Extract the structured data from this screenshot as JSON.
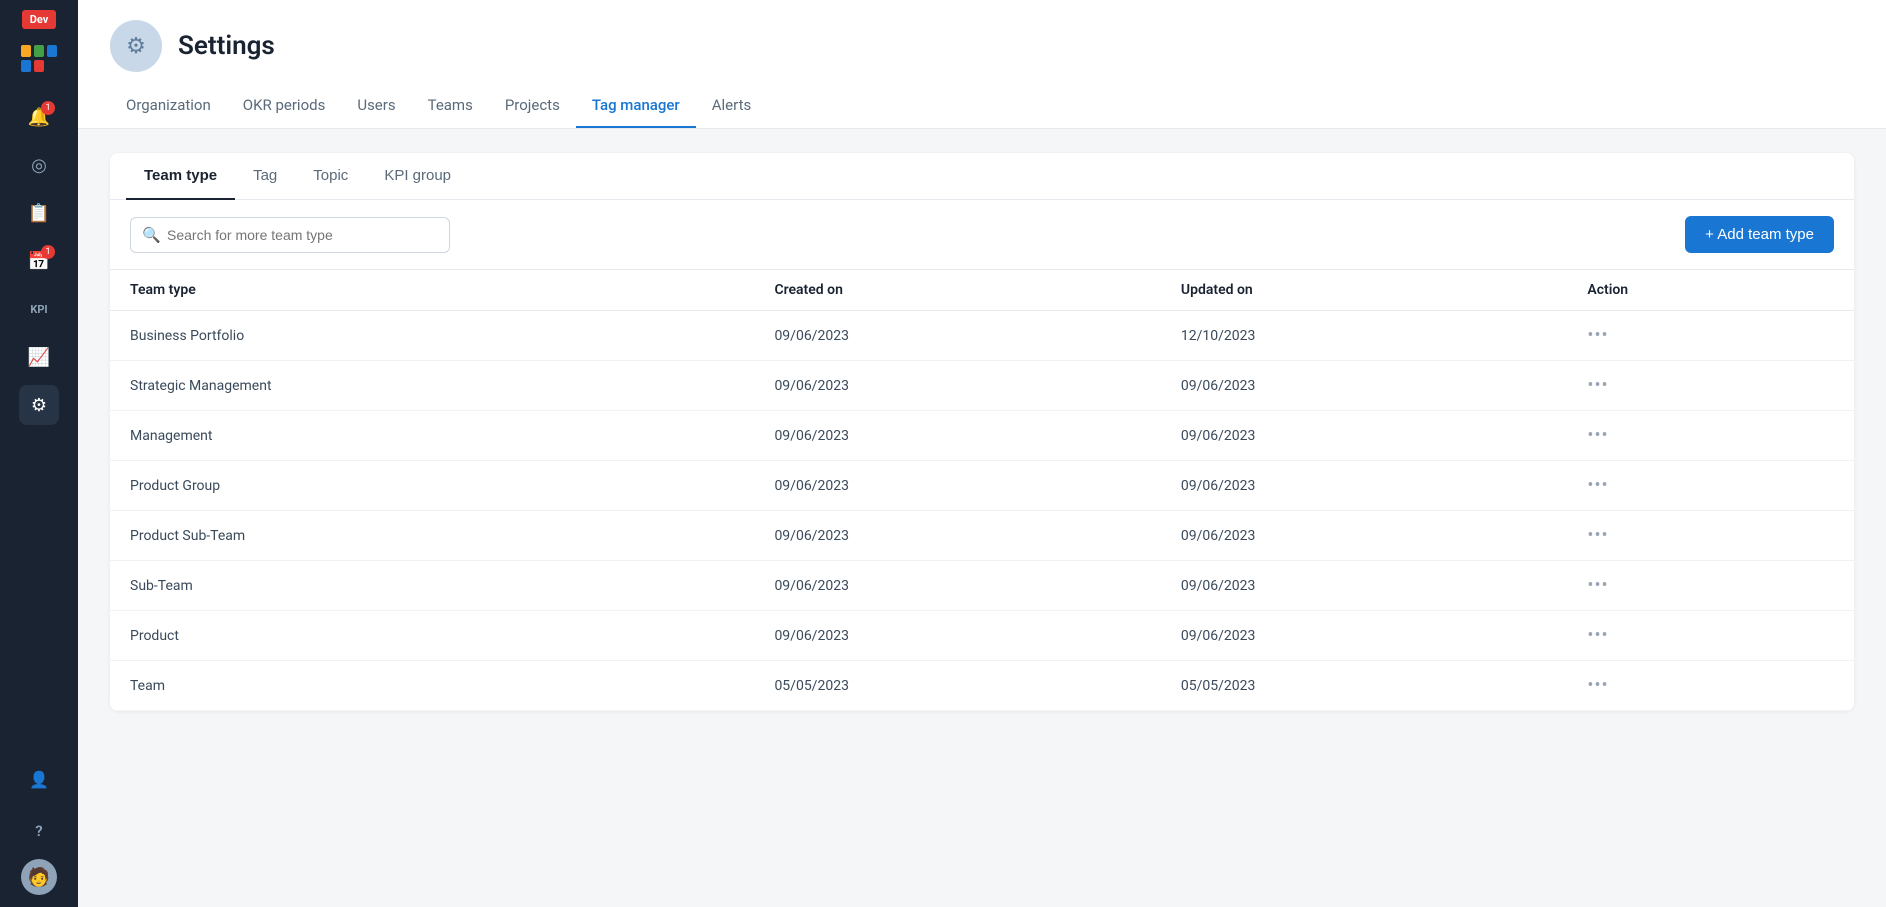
{
  "sidebar": {
    "dev_badge": "Dev",
    "icons": [
      {
        "name": "bell-icon",
        "symbol": "🔔",
        "badge": "1"
      },
      {
        "name": "target-icon",
        "symbol": "◎",
        "badge": null
      },
      {
        "name": "clipboard-icon",
        "symbol": "📋",
        "badge": null
      },
      {
        "name": "calendar-icon",
        "symbol": "📅",
        "badge": "1"
      },
      {
        "name": "kpi-icon",
        "symbol": "KPI",
        "badge": null
      },
      {
        "name": "chart-icon",
        "symbol": "📈",
        "badge": null
      },
      {
        "name": "settings-icon",
        "symbol": "⚙",
        "badge": null,
        "active": true
      }
    ],
    "bottom_icons": [
      {
        "name": "add-user-icon",
        "symbol": "👤+"
      },
      {
        "name": "help-icon",
        "symbol": "?"
      }
    ]
  },
  "header": {
    "title": "Settings",
    "nav_tabs": [
      {
        "label": "Organization",
        "active": false
      },
      {
        "label": "OKR periods",
        "active": false
      },
      {
        "label": "Users",
        "active": false
      },
      {
        "label": "Teams",
        "active": false
      },
      {
        "label": "Projects",
        "active": false
      },
      {
        "label": "Tag manager",
        "active": true
      },
      {
        "label": "Alerts",
        "active": false
      }
    ]
  },
  "tabs": [
    {
      "label": "Team type",
      "active": true
    },
    {
      "label": "Tag",
      "active": false
    },
    {
      "label": "Topic",
      "active": false
    },
    {
      "label": "KPI group",
      "active": false
    }
  ],
  "toolbar": {
    "search_placeholder": "Search for more team type",
    "add_button_label": "+ Add team type"
  },
  "table": {
    "columns": [
      "Team type",
      "Created on",
      "Updated on",
      "Action"
    ],
    "rows": [
      {
        "team_type": "Business Portfolio",
        "created_on": "09/06/2023",
        "updated_on": "12/10/2023"
      },
      {
        "team_type": "Strategic Management",
        "created_on": "09/06/2023",
        "updated_on": "09/06/2023"
      },
      {
        "team_type": "Management",
        "created_on": "09/06/2023",
        "updated_on": "09/06/2023"
      },
      {
        "team_type": "Product Group",
        "created_on": "09/06/2023",
        "updated_on": "09/06/2023"
      },
      {
        "team_type": "Product Sub-Team",
        "created_on": "09/06/2023",
        "updated_on": "09/06/2023"
      },
      {
        "team_type": "Sub-Team",
        "created_on": "09/06/2023",
        "updated_on": "09/06/2023"
      },
      {
        "team_type": "Product",
        "created_on": "09/06/2023",
        "updated_on": "09/06/2023"
      },
      {
        "team_type": "Team",
        "created_on": "05/05/2023",
        "updated_on": "05/05/2023"
      }
    ]
  },
  "colors": {
    "accent": "#1976d2",
    "sidebar_bg": "#1a2332",
    "active_tab_border": "#1976d2"
  }
}
